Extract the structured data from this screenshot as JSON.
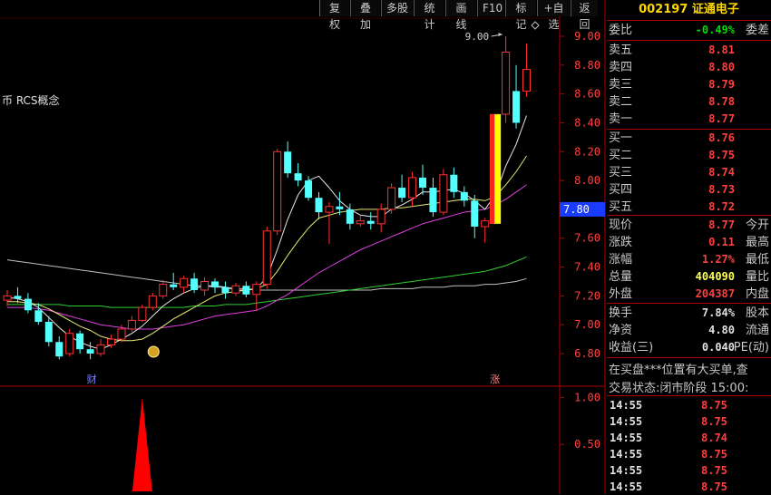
{
  "toolbar": {
    "buttons": [
      "复权",
      "叠加",
      "多股",
      "统计",
      "画线",
      "F10",
      "标记",
      "+自选",
      "返回"
    ]
  },
  "chart": {
    "indicator_label": "币 RCS概念",
    "high_marker": "9.00",
    "cursor_price": "7.80",
    "marker_cai": "财",
    "marker_zhang": "涨",
    "price_ticks": [
      "9.00",
      "8.80",
      "8.60",
      "8.40",
      "8.20",
      "8.00",
      "7.80",
      "7.60",
      "7.40",
      "7.20",
      "7.00",
      "6.80"
    ],
    "sub_ticks": [
      "1.00",
      "0.50"
    ]
  },
  "chart_data": {
    "type": "candlestick",
    "title": "",
    "ylim": [
      6.7,
      9.1
    ],
    "sub_ylim": [
      0,
      1.1
    ],
    "candles": [
      {
        "o": 7.17,
        "h": 7.24,
        "l": 7.13,
        "c": 7.2
      },
      {
        "o": 7.2,
        "h": 7.26,
        "l": 7.15,
        "c": 7.18
      },
      {
        "o": 7.18,
        "h": 7.22,
        "l": 7.08,
        "c": 7.1
      },
      {
        "o": 7.1,
        "h": 7.15,
        "l": 7.0,
        "c": 7.02
      },
      {
        "o": 7.02,
        "h": 7.06,
        "l": 6.85,
        "c": 6.88
      },
      {
        "o": 6.88,
        "h": 6.92,
        "l": 6.76,
        "c": 6.78
      },
      {
        "o": 6.8,
        "h": 6.97,
        "l": 6.78,
        "c": 6.94
      },
      {
        "o": 6.94,
        "h": 6.96,
        "l": 6.8,
        "c": 6.83
      },
      {
        "o": 6.83,
        "h": 6.88,
        "l": 6.76,
        "c": 6.8
      },
      {
        "o": 6.8,
        "h": 6.9,
        "l": 6.78,
        "c": 6.86
      },
      {
        "o": 6.86,
        "h": 6.93,
        "l": 6.84,
        "c": 6.9
      },
      {
        "o": 6.9,
        "h": 7.0,
        "l": 6.88,
        "c": 6.97
      },
      {
        "o": 6.97,
        "h": 7.06,
        "l": 6.95,
        "c": 7.03
      },
      {
        "o": 7.03,
        "h": 7.14,
        "l": 7.02,
        "c": 7.12
      },
      {
        "o": 7.12,
        "h": 7.22,
        "l": 7.1,
        "c": 7.2
      },
      {
        "o": 7.2,
        "h": 7.31,
        "l": 7.18,
        "c": 7.28
      },
      {
        "o": 7.28,
        "h": 7.36,
        "l": 7.24,
        "c": 7.26
      },
      {
        "o": 7.26,
        "h": 7.34,
        "l": 7.22,
        "c": 7.32
      },
      {
        "o": 7.32,
        "h": 7.36,
        "l": 7.22,
        "c": 7.24
      },
      {
        "o": 7.24,
        "h": 7.33,
        "l": 7.2,
        "c": 7.3
      },
      {
        "o": 7.3,
        "h": 7.32,
        "l": 7.22,
        "c": 7.26
      },
      {
        "o": 7.26,
        "h": 7.3,
        "l": 7.18,
        "c": 7.22
      },
      {
        "o": 7.22,
        "h": 7.29,
        "l": 7.2,
        "c": 7.27
      },
      {
        "o": 7.27,
        "h": 7.3,
        "l": 7.19,
        "c": 7.21
      },
      {
        "o": 7.21,
        "h": 7.3,
        "l": 7.1,
        "c": 7.28
      },
      {
        "o": 7.28,
        "h": 7.68,
        "l": 7.25,
        "c": 7.65
      },
      {
        "o": 7.65,
        "h": 8.22,
        "l": 7.62,
        "c": 8.2
      },
      {
        "o": 8.2,
        "h": 8.27,
        "l": 8.02,
        "c": 8.05
      },
      {
        "o": 8.05,
        "h": 8.12,
        "l": 7.96,
        "c": 8.0
      },
      {
        "o": 8.0,
        "h": 8.03,
        "l": 7.86,
        "c": 7.88
      },
      {
        "o": 7.88,
        "h": 7.92,
        "l": 7.73,
        "c": 7.78
      },
      {
        "o": 7.78,
        "h": 7.85,
        "l": 7.56,
        "c": 7.82
      },
      {
        "o": 7.82,
        "h": 7.92,
        "l": 7.76,
        "c": 7.8
      },
      {
        "o": 7.8,
        "h": 7.84,
        "l": 7.66,
        "c": 7.7
      },
      {
        "o": 7.7,
        "h": 7.76,
        "l": 7.68,
        "c": 7.72
      },
      {
        "o": 7.72,
        "h": 7.78,
        "l": 7.66,
        "c": 7.7
      },
      {
        "o": 7.7,
        "h": 7.84,
        "l": 7.64,
        "c": 7.8
      },
      {
        "o": 7.8,
        "h": 7.98,
        "l": 7.77,
        "c": 7.95
      },
      {
        "o": 7.95,
        "h": 8.04,
        "l": 7.85,
        "c": 7.88
      },
      {
        "o": 7.88,
        "h": 8.06,
        "l": 7.82,
        "c": 8.02
      },
      {
        "o": 8.02,
        "h": 8.11,
        "l": 7.9,
        "c": 7.95
      },
      {
        "o": 7.95,
        "h": 8.02,
        "l": 7.75,
        "c": 7.78
      },
      {
        "o": 7.78,
        "h": 8.08,
        "l": 7.76,
        "c": 8.04
      },
      {
        "o": 8.04,
        "h": 8.09,
        "l": 7.88,
        "c": 7.92
      },
      {
        "o": 7.92,
        "h": 7.96,
        "l": 7.82,
        "c": 7.86
      },
      {
        "o": 7.86,
        "h": 7.9,
        "l": 7.6,
        "c": 7.68
      },
      {
        "o": 7.68,
        "h": 7.74,
        "l": 7.57,
        "c": 7.72
      },
      {
        "o": 7.7,
        "h": 8.46,
        "l": 7.7,
        "c": 8.46
      },
      {
        "o": 8.46,
        "h": 9.0,
        "l": 8.4,
        "c": 8.89
      },
      {
        "o": 8.62,
        "h": 8.8,
        "l": 8.36,
        "c": 8.4
      },
      {
        "o": 8.62,
        "h": 8.95,
        "l": 8.58,
        "c": 8.77
      }
    ],
    "ma5": [
      7.19,
      7.18,
      7.16,
      7.12,
      7.05,
      6.98,
      6.92,
      6.88,
      6.85,
      6.83,
      6.86,
      6.9,
      6.94,
      6.99,
      7.06,
      7.13,
      7.18,
      7.22,
      7.25,
      7.27,
      7.27,
      7.26,
      7.24,
      7.24,
      7.25,
      7.33,
      7.52,
      7.73,
      7.9,
      8.0,
      8.03,
      7.95,
      7.86,
      7.8,
      7.76,
      7.75,
      7.75,
      7.8,
      7.83,
      7.87,
      7.92,
      7.92,
      7.93,
      7.94,
      7.91,
      7.86,
      7.8,
      7.9,
      8.1,
      8.25,
      8.45
    ],
    "ma10": [
      7.16,
      7.16,
      7.15,
      7.14,
      7.11,
      7.07,
      7.03,
      6.99,
      6.96,
      6.92,
      6.9,
      6.89,
      6.89,
      6.9,
      6.94,
      6.99,
      7.04,
      7.08,
      7.12,
      7.16,
      7.2,
      7.22,
      7.23,
      7.24,
      7.25,
      7.28,
      7.37,
      7.48,
      7.58,
      7.67,
      7.74,
      7.76,
      7.78,
      7.79,
      7.8,
      7.8,
      7.8,
      7.81,
      7.81,
      7.82,
      7.83,
      7.84,
      7.85,
      7.86,
      7.87,
      7.87,
      7.86,
      7.89,
      7.97,
      8.06,
      8.17
    ],
    "ma20": [
      7.12,
      7.12,
      7.12,
      7.11,
      7.1,
      7.08,
      7.06,
      7.04,
      7.02,
      7.0,
      6.99,
      6.98,
      6.97,
      6.97,
      6.97,
      6.98,
      6.99,
      7.0,
      7.02,
      7.04,
      7.06,
      7.07,
      7.08,
      7.09,
      7.1,
      7.13,
      7.17,
      7.21,
      7.26,
      7.31,
      7.36,
      7.4,
      7.44,
      7.48,
      7.52,
      7.55,
      7.58,
      7.61,
      7.64,
      7.67,
      7.7,
      7.72,
      7.74,
      7.76,
      7.78,
      7.79,
      7.8,
      7.83,
      7.87,
      7.92,
      7.97
    ],
    "ma60": [
      7.14,
      7.14,
      7.14,
      7.14,
      7.14,
      7.14,
      7.13,
      7.13,
      7.13,
      7.13,
      7.12,
      7.12,
      7.12,
      7.12,
      7.12,
      7.12,
      7.12,
      7.12,
      7.13,
      7.13,
      7.13,
      7.14,
      7.14,
      7.14,
      7.15,
      7.16,
      7.17,
      7.18,
      7.19,
      7.2,
      7.21,
      7.22,
      7.23,
      7.24,
      7.25,
      7.26,
      7.27,
      7.28,
      7.29,
      7.3,
      7.31,
      7.32,
      7.33,
      7.34,
      7.35,
      7.36,
      7.37,
      7.39,
      7.41,
      7.44,
      7.47
    ],
    "ma120": [
      7.45,
      7.44,
      7.43,
      7.42,
      7.41,
      7.4,
      7.39,
      7.38,
      7.37,
      7.36,
      7.35,
      7.34,
      7.33,
      7.32,
      7.31,
      7.3,
      7.29,
      7.28,
      7.27,
      7.27,
      7.26,
      7.26,
      7.25,
      7.25,
      7.24,
      7.24,
      7.24,
      7.24,
      7.24,
      7.24,
      7.24,
      7.24,
      7.24,
      7.24,
      7.24,
      7.24,
      7.25,
      7.25,
      7.25,
      7.25,
      7.26,
      7.26,
      7.26,
      7.27,
      7.27,
      7.27,
      7.28,
      7.28,
      7.29,
      7.3,
      7.32
    ],
    "signal_spike_index": 13,
    "signal_value": 1.0,
    "strong_bar_index": 47
  },
  "panel": {
    "code": "002197",
    "name": "证通电子",
    "weibi_label": "委比",
    "weibi_value": "-0.49%",
    "weicha_label": "委差",
    "asks": [
      {
        "label": "卖五",
        "price": "8.81"
      },
      {
        "label": "卖四",
        "price": "8.80"
      },
      {
        "label": "卖三",
        "price": "8.79"
      },
      {
        "label": "卖二",
        "price": "8.78"
      },
      {
        "label": "卖一",
        "price": "8.77"
      }
    ],
    "bids": [
      {
        "label": "买一",
        "price": "8.76"
      },
      {
        "label": "买二",
        "price": "8.75"
      },
      {
        "label": "买三",
        "price": "8.74"
      },
      {
        "label": "买四",
        "price": "8.73"
      },
      {
        "label": "买五",
        "price": "8.72"
      }
    ],
    "stats": [
      {
        "label": "现价",
        "value": "8.77",
        "right": "今开",
        "color": "red"
      },
      {
        "label": "涨跌",
        "value": "0.11",
        "right": "最高",
        "color": "red"
      },
      {
        "label": "涨幅",
        "value": "1.27%",
        "right": "最低",
        "color": "red"
      },
      {
        "label": "总量",
        "value": "404090",
        "right": "量比",
        "color": "yellow"
      },
      {
        "label": "外盘",
        "value": "204387",
        "right": "内盘",
        "color": "red"
      }
    ],
    "stats2": [
      {
        "label": "换手",
        "value": "7.84%",
        "right": "股本",
        "color": "white"
      },
      {
        "label": "净资",
        "value": "4.80",
        "right": "流通",
        "color": "white"
      },
      {
        "label": "收益(三)",
        "value": "0.040",
        "right": "PE(动)",
        "color": "white"
      }
    ],
    "message": "在买盘***位置有大买单,查",
    "status_label": "交易状态:",
    "status_value": "闭市阶段",
    "status_time": "15:00:",
    "ticks": [
      {
        "time": "14:55",
        "price": "8.75"
      },
      {
        "time": "14:55",
        "price": "8.75"
      },
      {
        "time": "14:55",
        "price": "8.74"
      },
      {
        "time": "14:55",
        "price": "8.75"
      },
      {
        "time": "14:55",
        "price": "8.75"
      },
      {
        "time": "14:55",
        "price": "8.75"
      }
    ]
  },
  "colors": {
    "up": "#ff3030",
    "down": "#54ffff",
    "ma5": "#e8e8e8",
    "ma10": "#e8e870",
    "ma20": "#e040e0",
    "ma60": "#30d030",
    "ma120": "#c0c0c0",
    "frame": "#b00000"
  }
}
